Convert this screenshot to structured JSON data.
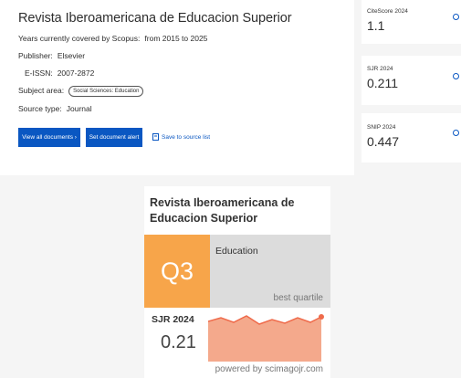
{
  "source": {
    "title": "Revista Iberoamericana de Educacion Superior",
    "years_label": "Years currently covered by Scopus:",
    "years_value": "from 2015 to 2025",
    "publisher_label": "Publisher:",
    "publisher_value": "Elsevier",
    "eissn_label": "E-ISSN:",
    "eissn_value": "2007-2872",
    "subject_label": "Subject area:",
    "subject_value": "Social Sciences: Education",
    "type_label": "Source type:",
    "type_value": "Journal"
  },
  "actions": {
    "view_all": "View all documents ›",
    "set_alert": "Set document alert",
    "save": "Save to source list"
  },
  "metrics": [
    {
      "label": "CiteScore 2024",
      "value": "1.1"
    },
    {
      "label": "SJR 2024",
      "value": "0.211"
    },
    {
      "label": "SNIP 2024",
      "value": "0.447"
    }
  ],
  "scimago": {
    "title": "Revista Iberoamericana de Educacion Superior",
    "quartile": "Q3",
    "subject": "Education",
    "quartile_note": "best quartile",
    "sjr_label": "SJR 2024",
    "sjr_value": "0.21",
    "powered": "powered by scimagojr.com"
  },
  "colors": {
    "button_blue": "#0a57c2",
    "quartile_orange": "#f7a54a",
    "spark_fill": "#f4a98c",
    "spark_line": "#ef6b4b"
  }
}
